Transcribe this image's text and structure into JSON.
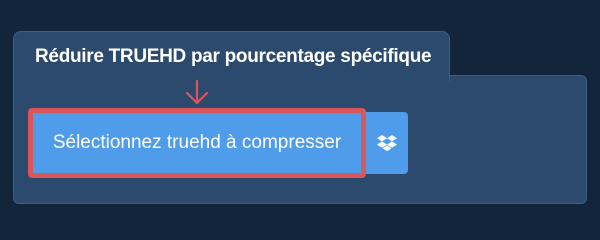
{
  "panel": {
    "title": "Réduire TRUEHD par pourcentage spécifique"
  },
  "upload": {
    "select_label": "Sélectionnez truehd à compresser",
    "cloud_icon": "dropbox-icon",
    "pointer_icon": "arrow-down-icon"
  },
  "colors": {
    "page_background": "#13253a",
    "panel_background": "#2c4a6d",
    "button_background": "#4f9ceb",
    "highlight_border": "#d9575a"
  }
}
